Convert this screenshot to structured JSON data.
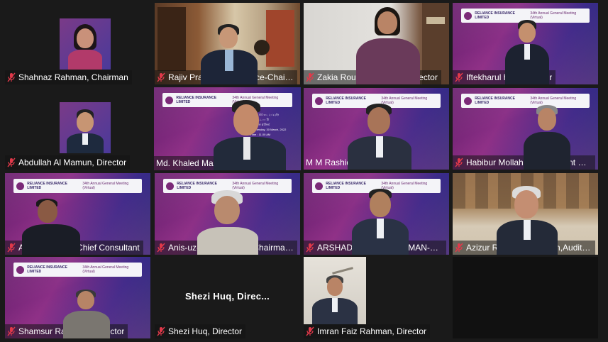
{
  "accent": "#c9d63a",
  "mic_muted_color": "#e0394a",
  "banner": {
    "company_bn": "আমরা আমাদের বাংলা",
    "company_en": "RELIANCE INSURANCE LIMITED",
    "agm_bn": "৩৪তম বার্ষিক সাধারণ সভা (ভার্চুয়াল)",
    "agm_en": "34th Annual General Meeting (Virtual)",
    "date_bn": "বুধবার, মার্চ ৩০, ২০২২ইং",
    "time_bn": "সময় : ১১.০০ টা",
    "platform_bn": "ডিজিটাল প্লাটফর্ম",
    "date_en": "Wednesday, 30 March, 2022",
    "time_en": "Time : 11.00 AM",
    "platform_en": "Digital Platform"
  },
  "participants": [
    {
      "name": "Shahnaz Rahman, Chairman",
      "muted": true
    },
    {
      "name": "Rajiv Prasad Shaha, Vice-Chairm...",
      "muted": true
    },
    {
      "name": "Zakia Rouf Chowdhury, Director",
      "muted": true
    },
    {
      "name": "Iftekharul huq, Director",
      "muted": true
    },
    {
      "name": "Abdullah Al Mamun, Director",
      "muted": true
    },
    {
      "name": "Md. Khaled Mamun, CEO",
      "muted": false
    },
    {
      "name": "M M Rashid, CS",
      "muted": false
    },
    {
      "name": "Habibur Mollah, Independent Di...",
      "muted": true
    },
    {
      "name": "Akhtar Ahmed, Chief Consultant",
      "muted": true
    },
    {
      "name": "Anis-uz-Zaman Khan, Chairman,...",
      "muted": true
    },
    {
      "name": "ARSHAD WALIUR RAHMAN-DIRE...",
      "muted": true
    },
    {
      "name": "Azizur Rashid, Chairman,Audit C...",
      "muted": true
    },
    {
      "name": "Shamsur Rahman - Director",
      "muted": true
    },
    {
      "name": "Shezi Huq, Director",
      "muted": true
    },
    {
      "name": "Imran Faiz Rahman, Director",
      "muted": true
    }
  ],
  "no_video_display_name": "Shezi  Huq,  Direc..."
}
